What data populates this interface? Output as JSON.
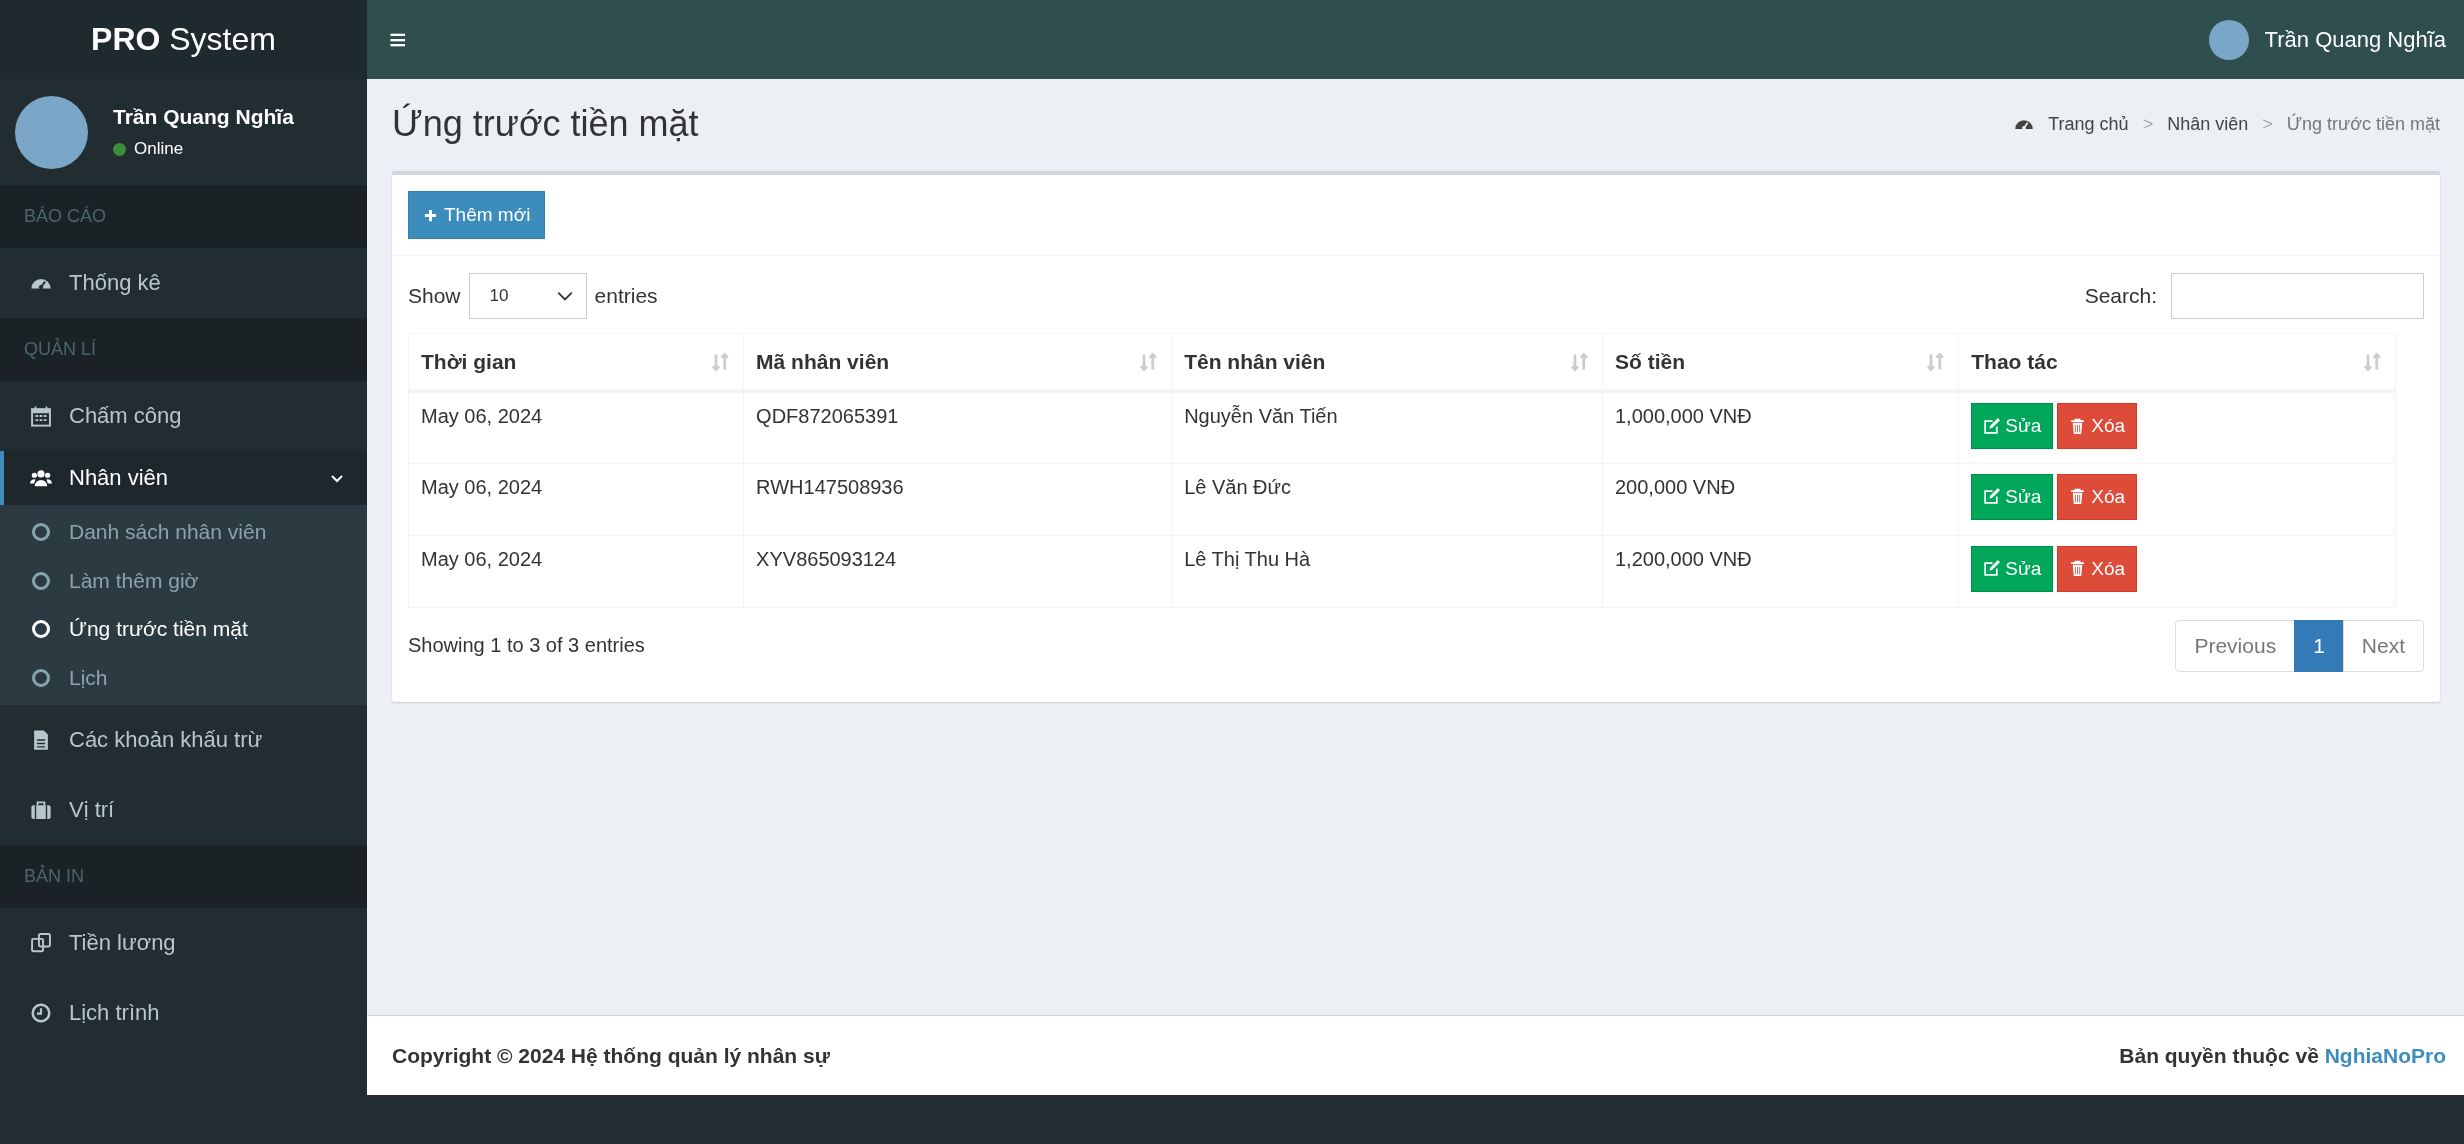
{
  "brand": {
    "bold": "PRO",
    "rest": "System"
  },
  "sidebar": {
    "user": {
      "name": "Trần Quang Nghĩa",
      "status": "Online"
    },
    "sections": [
      {
        "header": "BÁO CÁO",
        "items": [
          {
            "label": "Thống kê",
            "selected": false
          }
        ]
      },
      {
        "header": "QUẢN LÍ",
        "items": [
          {
            "label": "Chấm công",
            "selected": false
          },
          {
            "label": "Nhân viên",
            "selected": true,
            "expanded": true,
            "children": [
              {
                "label": "Danh sách nhân viên",
                "selected": false
              },
              {
                "label": "Làm thêm giờ",
                "selected": false
              },
              {
                "label": "Ứng trước tiền mặt",
                "selected": true
              },
              {
                "label": "Lịch",
                "selected": false
              }
            ]
          },
          {
            "label": "Các khoản khấu trừ",
            "selected": false
          },
          {
            "label": "Vị trí",
            "selected": false
          }
        ]
      },
      {
        "header": "BẢN IN",
        "items": [
          {
            "label": "Tiền lương",
            "selected": false
          },
          {
            "label": "Lịch trình",
            "selected": false
          }
        ]
      }
    ]
  },
  "topbar": {
    "menu_glyph": "≡",
    "user_name": "Trần Quang Nghĩa"
  },
  "page_title": "Ứng trước tiền mặt",
  "breadcrumb": [
    {
      "label": "Trang chủ"
    },
    {
      "separator": ">",
      "label": "Nhân viên"
    },
    {
      "separator": ">",
      "label": "Ứng trước tiền mặt"
    }
  ],
  "add_button": "Thêm mới",
  "length": {
    "before": "Show",
    "value": "10",
    "after": "entries"
  },
  "search": {
    "label": "Search:"
  },
  "table": {
    "columns": [
      {
        "label": "Thời gian",
        "sortable": true
      },
      {
        "label": "Mã nhân viên",
        "sortable": true
      },
      {
        "label": "Tên nhân viên",
        "sortable": true
      },
      {
        "label": "Số tiền",
        "sortable": true
      },
      {
        "label": "Thao tác",
        "sortable": true
      }
    ],
    "rows": [
      {
        "cells": [
          "May 06, 2024",
          "QDF872065391",
          "Nguyễn Văn Tiến",
          "1,000,000 VNĐ"
        ],
        "actions": [
          {
            "kind": "edit",
            "label": "Sửa"
          },
          {
            "kind": "delete",
            "label": "Xóa"
          }
        ]
      },
      {
        "cells": [
          "May 06, 2024",
          "RWH147508936",
          "Lê Văn Đức",
          "200,000 VNĐ"
        ],
        "actions": [
          {
            "kind": "edit",
            "label": "Sửa"
          },
          {
            "kind": "delete",
            "label": "Xóa"
          }
        ]
      },
      {
        "cells": [
          "May 06, 2024",
          "XYV865093124",
          "Lê Thị Thu Hà",
          "1,200,000 VNĐ"
        ],
        "actions": [
          {
            "kind": "edit",
            "label": "Sửa"
          },
          {
            "kind": "delete",
            "label": "Xóa"
          }
        ]
      }
    ]
  },
  "info": "Showing 1 to 3 of 3 entries",
  "pagination": [
    {
      "label": "Previous",
      "selected": false,
      "disabled": true
    },
    {
      "label": "1",
      "selected": true,
      "disabled": false
    },
    {
      "label": "Next",
      "selected": false,
      "disabled": true
    }
  ],
  "footer": {
    "copyright": "Copyright © 2024 Hệ thống quản lý nhân sự",
    "rights": "Bản quyền thuộc về",
    "link": "NghiaNoPro"
  }
}
